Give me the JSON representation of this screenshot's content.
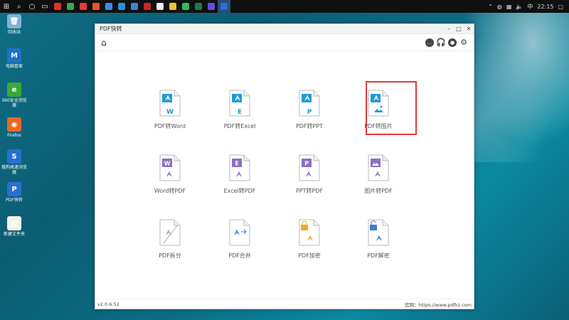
{
  "taskbar": {
    "apps": [
      {
        "name": "app-red",
        "color": "#d9342b"
      },
      {
        "name": "app-chrome",
        "color": "#34a853"
      },
      {
        "name": "app-netease",
        "color": "#e23c3c"
      },
      {
        "name": "app-globe",
        "color": "#e8542a"
      },
      {
        "name": "app-feather",
        "color": "#3a8ee6"
      },
      {
        "name": "app-edge",
        "color": "#2a8fd8"
      },
      {
        "name": "app-photos",
        "color": "#3d84d6"
      },
      {
        "name": "app-red2",
        "color": "#c62828"
      },
      {
        "name": "app-qq",
        "color": "#f0f0f0"
      },
      {
        "name": "app-browser",
        "color": "#f1c232"
      },
      {
        "name": "app-wechat",
        "color": "#2dbd5a"
      },
      {
        "name": "app-excel",
        "color": "#1f7a45"
      },
      {
        "name": "app-purple",
        "color": "#6a4bd8"
      },
      {
        "name": "app-pdf",
        "color": "#2b6fd1"
      }
    ],
    "tray_ime": "中",
    "time": "22:15"
  },
  "desktop": {
    "icons": [
      {
        "label": "回收站",
        "glyph": "🗑",
        "color": "#7fb3d9"
      },
      {
        "label": "电脑管家",
        "glyph": "M",
        "color": "#1a73c9"
      },
      {
        "label": "360安全浏览器",
        "glyph": "e",
        "color": "#3aa83a"
      },
      {
        "label": "Firefox",
        "glyph": "◉",
        "color": "#e8692a"
      },
      {
        "label": "搜狗高速浏览器",
        "glyph": "S",
        "color": "#2a6fd0"
      },
      {
        "label": "PDF快转",
        "glyph": "P",
        "color": "#2b6fd1"
      },
      {
        "label": "新建文件夹",
        "glyph": "▤",
        "color": "#f2f2e6"
      }
    ]
  },
  "window": {
    "title": "PDF快转",
    "controls": {
      "min": "–",
      "max": "□",
      "close": "✕"
    },
    "version": "v2.0.6.52",
    "website": "官网：https://www.pdfkz.com"
  },
  "tiles": [
    {
      "label": "PDF转Word",
      "badge": "W",
      "color": "#1e9bd7",
      "kind": "pdf"
    },
    {
      "label": "PDF转Excel",
      "badge": "E",
      "color": "#1e9bd7",
      "kind": "pdf"
    },
    {
      "label": "PDF转PPT",
      "badge": "P",
      "color": "#1e9bd7",
      "kind": "pdf"
    },
    {
      "label": "PDF转图片",
      "badge": "img",
      "color": "#1e9bd7",
      "kind": "pdf"
    },
    {
      "label": "Word转PDF",
      "badge": "W",
      "color": "#8a6fc2",
      "kind": "to"
    },
    {
      "label": "Excel转PDF",
      "badge": "E",
      "color": "#8a6fc2",
      "kind": "to"
    },
    {
      "label": "PPT转PDF",
      "badge": "P",
      "color": "#8a6fc2",
      "kind": "to"
    },
    {
      "label": "图片转PDF",
      "badge": "img",
      "color": "#8a6fc2",
      "kind": "to"
    },
    {
      "label": "PDF拆分",
      "badge": "split",
      "color": "#9a9a9a",
      "kind": "tool"
    },
    {
      "label": "PDF合并",
      "badge": "merge",
      "color": "#3a7bd5",
      "kind": "tool"
    },
    {
      "label": "PDF加密",
      "badge": "lock",
      "color": "#f0a830",
      "kind": "tool"
    },
    {
      "label": "PDF解密",
      "badge": "unlock",
      "color": "#3a7bd5",
      "kind": "tool"
    }
  ]
}
